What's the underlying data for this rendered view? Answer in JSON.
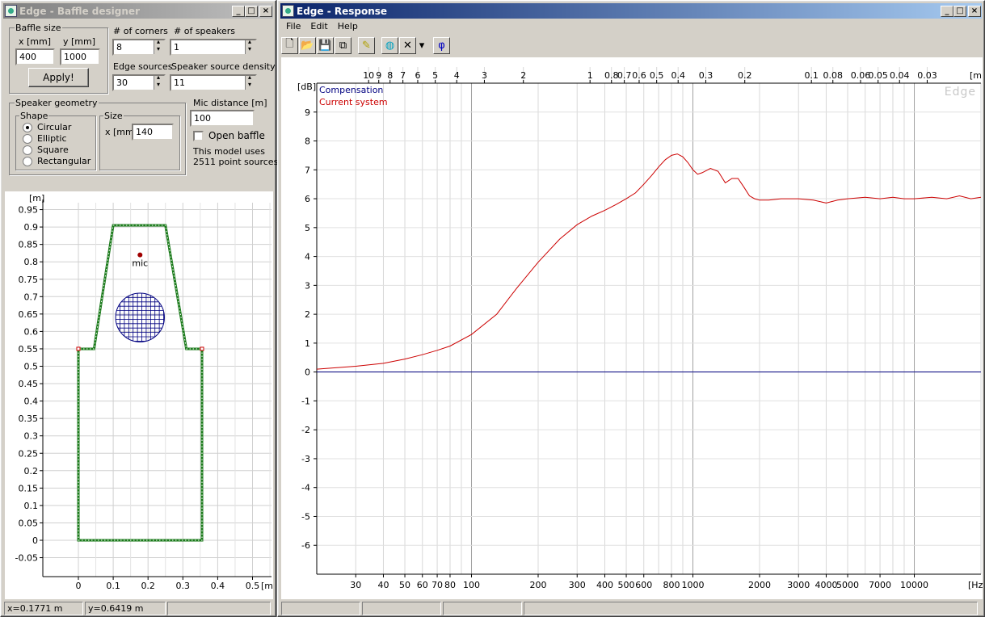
{
  "baffle_window": {
    "title": "Edge - Baffle designer",
    "baffle_size": {
      "group_label": "Baffle size",
      "x_label": "x [mm]",
      "y_label": "y [mm]",
      "x_value": "400",
      "y_value": "1000",
      "apply_label": "Apply!"
    },
    "corners": {
      "label": "# of corners",
      "value": "8"
    },
    "speakers": {
      "label": "# of speakers",
      "value": "1"
    },
    "edge_sources": {
      "label": "Edge sources",
      "value": "30"
    },
    "speaker_density": {
      "label": "Speaker source density",
      "value": "11"
    },
    "speaker_geometry": {
      "group_label": "Speaker geometry",
      "shape_label": "Shape",
      "shapes": [
        "Circular",
        "Elliptic",
        "Square",
        "Rectangular"
      ],
      "selected_shape": "Circular",
      "size_label": "Size",
      "size_x_label": "x [mm]",
      "size_x_value": "140"
    },
    "mic_distance": {
      "label": "Mic distance [m]",
      "value": "100"
    },
    "open_baffle": {
      "label": "Open baffle",
      "checked": false
    },
    "model_info_1": "This model uses",
    "model_info_2": "2511 point sources",
    "plot": {
      "y_unit": "[m]",
      "x_unit": "[m]",
      "y_ticks": [
        "0.95",
        "0.9",
        "0.85",
        "0.8",
        "0.75",
        "0.7",
        "0.65",
        "0.6",
        "0.55",
        "0.5",
        "0.45",
        "0.4",
        "0.35",
        "0.3",
        "0.25",
        "0.2",
        "0.15",
        "0.1",
        "0.05",
        "0",
        "-0.05"
      ],
      "x_ticks": [
        "0",
        "0.1",
        "0.2",
        "0.3",
        "0.4",
        "0.5"
      ],
      "mic_label": "mic",
      "baffle_color": "#1a7a1a",
      "speaker_color": "#000080"
    },
    "status": {
      "x": "x=0.1771 m",
      "y": "y=0.6419 m"
    }
  },
  "response_window": {
    "title": "Edge - Response",
    "menu": [
      "File",
      "Edit",
      "Help"
    ],
    "toolbar": [
      {
        "name": "new-icon",
        "glyph": "🗋"
      },
      {
        "name": "open-icon",
        "glyph": "📂"
      },
      {
        "name": "save-icon",
        "glyph": "💾"
      },
      {
        "name": "copy-icon",
        "glyph": "⧉"
      },
      {
        "name": "pen-icon",
        "glyph": "✎"
      },
      {
        "name": "globe-icon",
        "glyph": "◍"
      },
      {
        "name": "delete-icon",
        "glyph": "✕"
      },
      {
        "name": "dropdown-icon",
        "glyph": "▾"
      },
      {
        "name": "phase-icon",
        "glyph": "φ"
      }
    ],
    "chart": {
      "watermark": "Edge",
      "y_unit": "[dB]",
      "x_unit": "[Hz]",
      "top_unit": "[m]",
      "legend": [
        {
          "name": "Compensation",
          "color": "#000080"
        },
        {
          "name": "Current system",
          "color": "#cc0000"
        }
      ],
      "top_ticks": [
        "10",
        "9",
        "8",
        "7",
        "6",
        "5",
        "4",
        "3",
        "2",
        "1",
        "0.8",
        "0.7",
        "0.6",
        "0.5",
        "0.4",
        "0.3",
        "0.2",
        "0.1",
        "0.08",
        "0.06",
        "0.05",
        "0.04",
        "0.03"
      ],
      "x_ticks": [
        "30",
        "40",
        "50",
        "60",
        "70",
        "80",
        "100",
        "200",
        "300",
        "400",
        "500",
        "600",
        "800",
        "1000",
        "2000",
        "3000",
        "4000",
        "5000",
        "7000",
        "10000"
      ],
      "y_ticks": [
        "9",
        "8",
        "7",
        "6",
        "5",
        "4",
        "3",
        "2",
        "1",
        "0",
        "-1",
        "-2",
        "-3",
        "-4",
        "-5",
        "-6"
      ]
    }
  },
  "chart_data": {
    "type": "line",
    "title": "",
    "xlabel": "[Hz]",
    "ylabel": "[dB]",
    "xscale": "log",
    "xlim": [
      20,
      20000
    ],
    "ylim": [
      -7,
      10
    ],
    "grid": true,
    "series": [
      {
        "name": "Compensation",
        "color": "#000080",
        "x": [
          20,
          20000
        ],
        "y": [
          0,
          0
        ]
      },
      {
        "name": "Current system",
        "color": "#cc0000",
        "x": [
          20,
          30,
          40,
          50,
          60,
          70,
          80,
          100,
          130,
          160,
          200,
          250,
          300,
          350,
          400,
          450,
          500,
          550,
          600,
          650,
          700,
          750,
          800,
          850,
          900,
          950,
          1000,
          1050,
          1100,
          1200,
          1300,
          1400,
          1500,
          1600,
          1700,
          1800,
          1900,
          2000,
          2200,
          2500,
          3000,
          3500,
          4000,
          4500,
          5000,
          6000,
          7000,
          8000,
          9000,
          10000,
          12000,
          14000,
          16000,
          18000,
          20000
        ],
        "y": [
          0.1,
          0.2,
          0.3,
          0.45,
          0.6,
          0.75,
          0.9,
          1.3,
          2.0,
          2.9,
          3.8,
          4.6,
          5.1,
          5.4,
          5.6,
          5.8,
          6.0,
          6.2,
          6.5,
          6.8,
          7.1,
          7.35,
          7.5,
          7.55,
          7.45,
          7.25,
          7.0,
          6.85,
          6.9,
          7.05,
          6.95,
          6.55,
          6.7,
          6.7,
          6.4,
          6.1,
          6.0,
          5.95,
          5.95,
          6.0,
          6.0,
          5.95,
          5.85,
          5.95,
          6.0,
          6.05,
          6.0,
          6.05,
          6.0,
          6.0,
          6.05,
          6.0,
          6.1,
          6.0,
          6.05
        ]
      }
    ]
  }
}
